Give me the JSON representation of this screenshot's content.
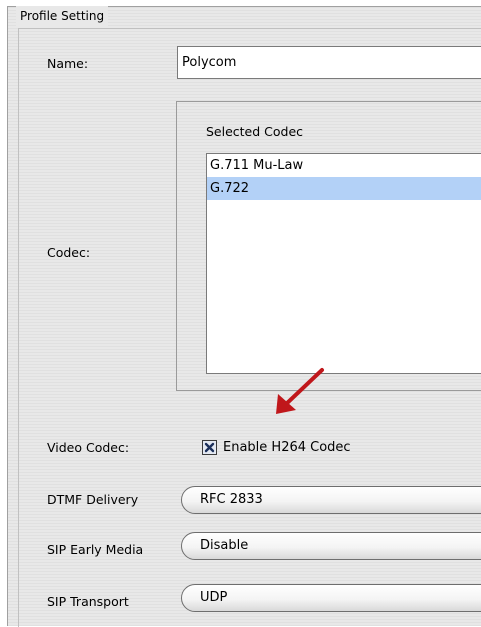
{
  "profile": {
    "legend": "Profile Setting",
    "name_label": "Name:",
    "name_value": "Polycom",
    "codec_label": "Codec:",
    "selected_codec_title": "Selected Codec",
    "codecs": [
      {
        "label": "G.711 Mu-Law",
        "selected": false
      },
      {
        "label": "G.722",
        "selected": true
      }
    ],
    "video_codec_label": "Video Codec:",
    "enable_h264_label": "Enable H264 Codec",
    "enable_h264_checked": true,
    "dtmf_label": "DTMF Delivery",
    "dtmf_value": "RFC 2833",
    "early_media_label": "SIP Early Media",
    "early_media_value": "Disable",
    "transport_label": "SIP Transport",
    "transport_value": "UDP"
  },
  "colors": {
    "panel_bg": "#e8e8e8",
    "selection": "#b3d1f7",
    "annotation_arrow": "#c0171b"
  },
  "icons": {
    "checkbox_mark": "x-checkmark-icon",
    "annotation": "red-arrow-icon"
  }
}
